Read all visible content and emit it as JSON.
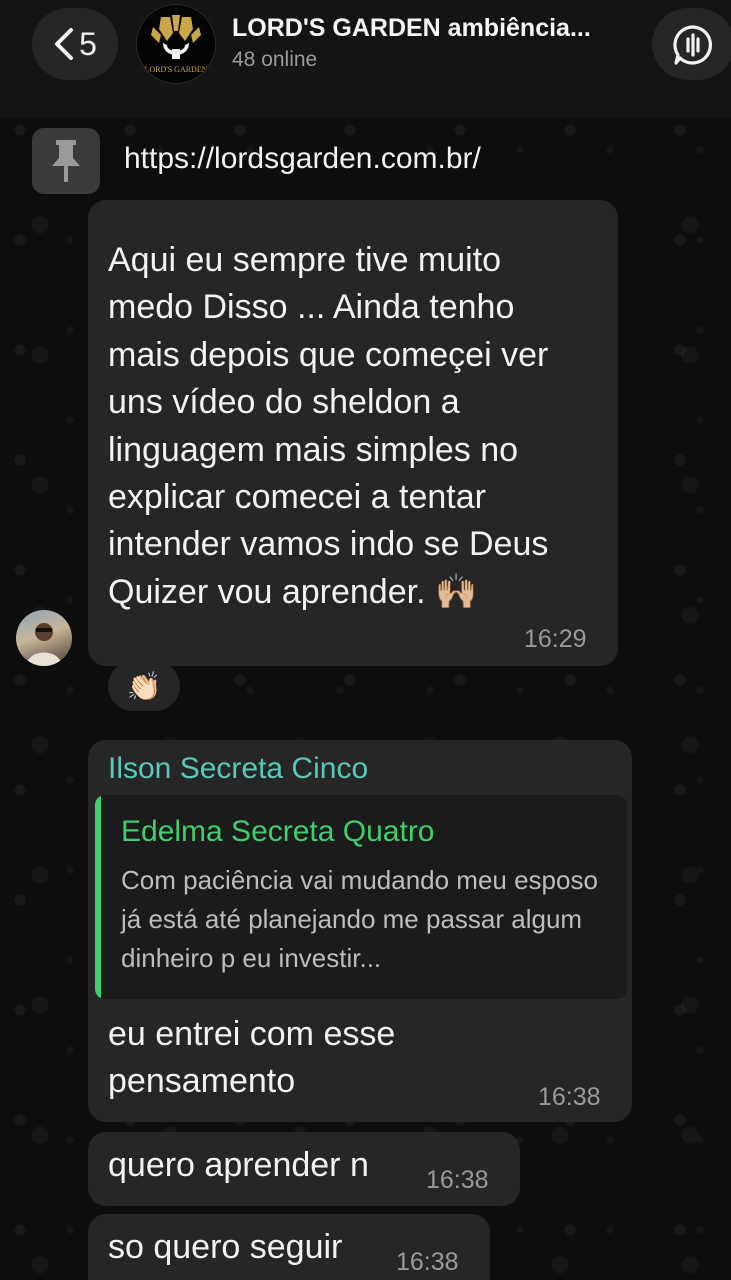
{
  "header": {
    "back_count": "5",
    "chat_title": "LORD'S GARDEN ambiência...",
    "subtitle": "48 online",
    "logo_text": "LORD'S GARDEN"
  },
  "pinned": {
    "link": "https://lordsgarden.com.br/"
  },
  "messages": [
    {
      "text": "Aqui eu sempre tive muito medo Disso ... Ainda tenho mais depois que começei ver uns vídeo do sheldon a linguagem mais simples no explicar comecei a tentar intender vamos indo se Deus Quizer vou aprender. 🙌🏼",
      "lines": [
        "Aqui eu sempre tive muito",
        "medo Disso ... Ainda tenho",
        "mais depois que começei ver",
        "uns vídeo do sheldon a",
        "linguagem mais simples no",
        "explicar comecei a tentar",
        "intender vamos indo se Deus",
        "Quizer vou aprender. 🙌🏼"
      ],
      "time": "16:29",
      "reaction": "👏🏻"
    },
    {
      "sender": "Ilson Secreta Cinco",
      "reply_to": {
        "name": "Edelma Secreta Quatro",
        "text": "Com paciência vai mudando meu esposo já está até planejando me passar algum dinheiro p eu investir..."
      },
      "lines": [
        "eu entrei com esse",
        "pensamento"
      ],
      "time": "16:38"
    },
    {
      "text": "quero aprender n",
      "time": "16:38"
    },
    {
      "text": "so quero seguir",
      "time": "16:38"
    }
  ],
  "colors": {
    "bubble": "#262626",
    "sender_name": "#5ac8b8",
    "reply_accent": "#3ecf6a",
    "timestamp": "#9a9a9a"
  }
}
